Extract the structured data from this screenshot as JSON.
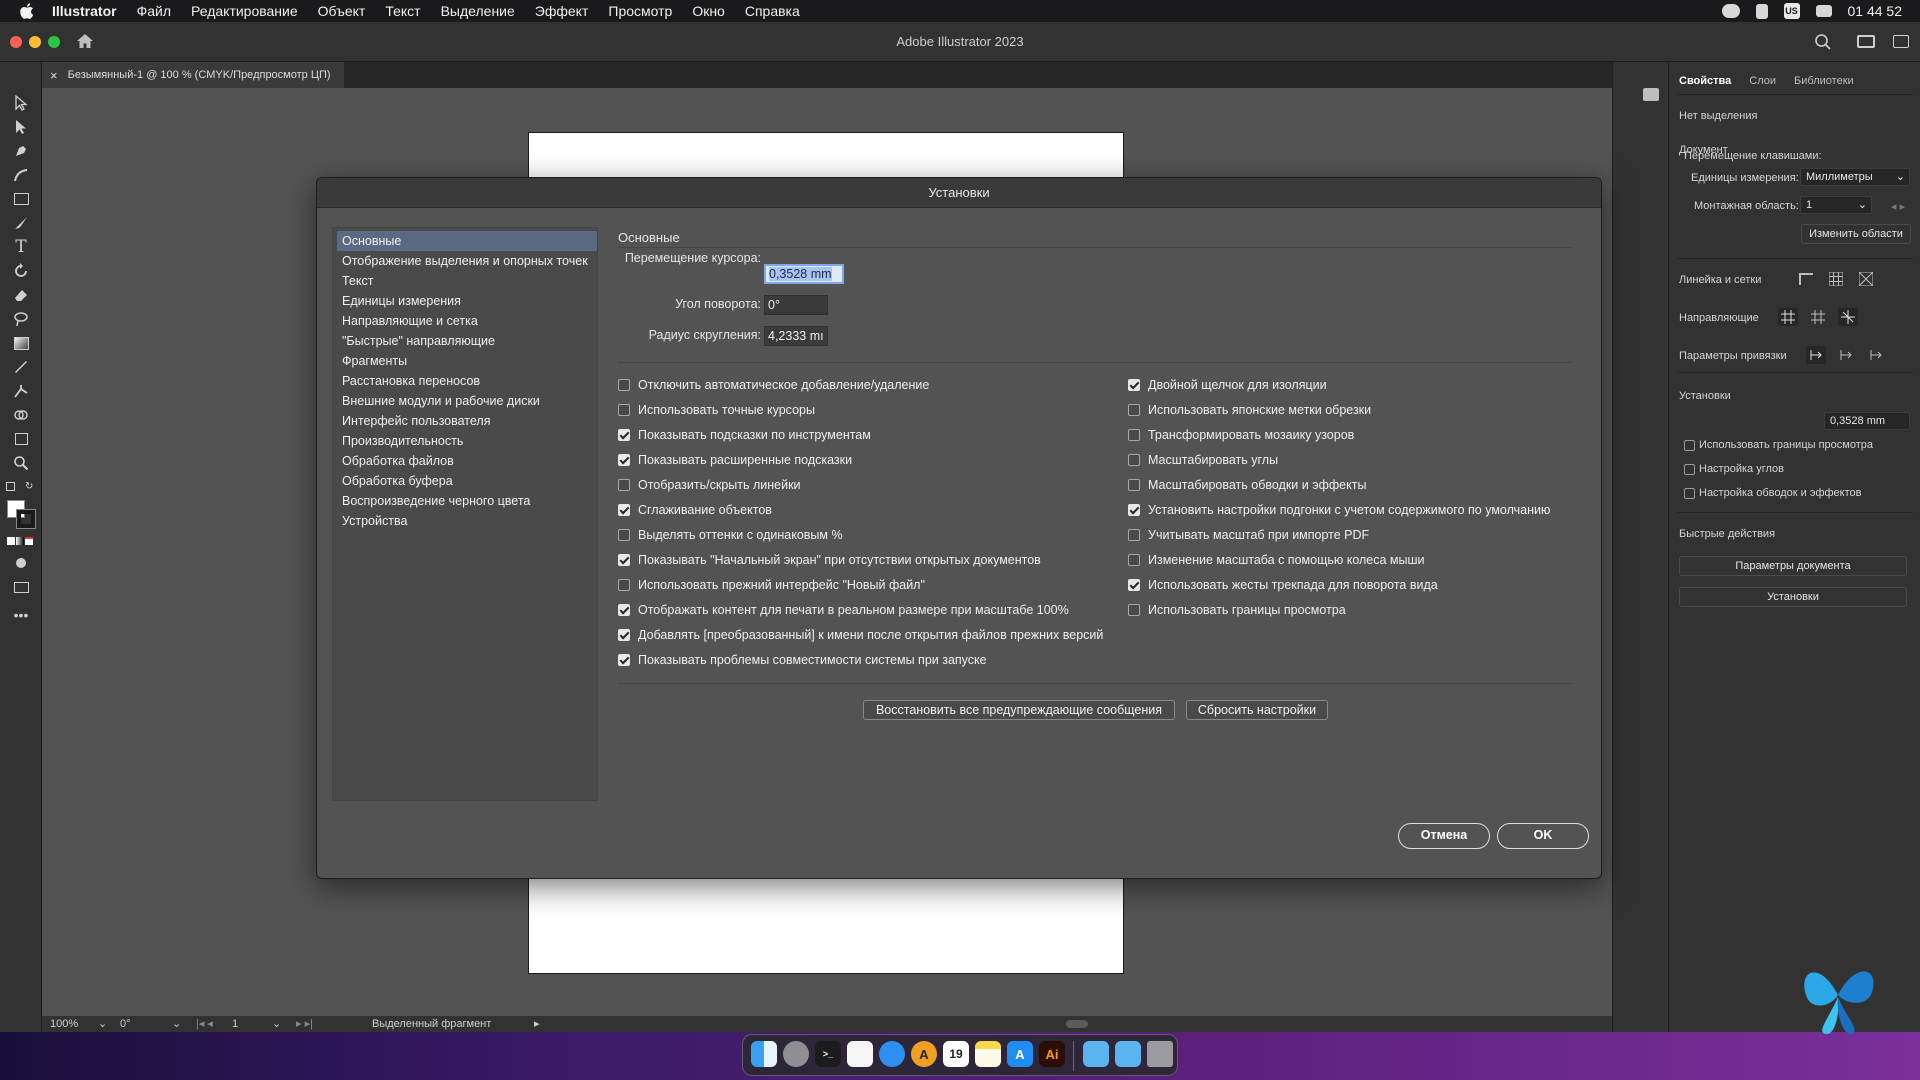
{
  "menubar": {
    "items": [
      "Illustrator",
      "Файл",
      "Редактирование",
      "Объект",
      "Текст",
      "Выделение",
      "Эффект",
      "Просмотр",
      "Окно",
      "Справка"
    ],
    "clock": "01 44 52",
    "input_source": "US"
  },
  "window": {
    "title": "Adobe Illustrator 2023"
  },
  "doc_tab": {
    "label": "Безымянный-1 @ 100 % (CMYK/Предпросмотр ЦП)",
    "close": "×"
  },
  "statusbar": {
    "zoom": "100%",
    "rotation": "0°",
    "artboard": "1",
    "info": "Выделенный фрагмент"
  },
  "props": {
    "tabs": [
      "Свойства",
      "Слои",
      "Библиотеки"
    ],
    "no_selection": "Нет выделения",
    "document": "Документ",
    "units_label": "Единицы измерения:",
    "units_value": "Миллиметры",
    "artboard_label": "Монтажная область:",
    "artboard_value": "1",
    "edit_artboards": "Изменить области",
    "rulers_grids": "Линейка и сетки",
    "guides": "Направляющие",
    "snap_options": "Параметры привязки",
    "preferences": "Установки",
    "keyboard_increment_label": "Перемещение клавишами:",
    "keyboard_increment_value": "0,3528 mm",
    "checks": [
      "Использовать границы просмотра",
      "Настройка углов",
      "Настройка обводок и эффектов"
    ],
    "quick_actions": "Быстрые действия",
    "doc_setup_btn": "Параметры документа",
    "prefs_btn": "Установки"
  },
  "dialog": {
    "title": "Установки",
    "nav": [
      "Основные",
      "Отображение выделения и опорных точек",
      "Текст",
      "Единицы измерения",
      "Направляющие и сетка",
      "\"Быстрые\" направляющие",
      "Фрагменты",
      "Расстановка переносов",
      "Внешние модули и рабочие диски",
      "Интерфейс пользователя",
      "Производительность",
      "Обработка файлов",
      "Обработка буфера",
      "Воспроизведение черного цвета",
      "Устройства"
    ],
    "section": "Основные",
    "fields": [
      {
        "label": "Перемещение курсора:",
        "value": "0,3528 mm"
      },
      {
        "label": "Угол поворота:",
        "value": "0°"
      },
      {
        "label": "Радиус скругления:",
        "value": "4,2333 mı"
      }
    ],
    "left_checks": [
      {
        "label": "Отключить автоматическое добавление/удаление",
        "checked": false
      },
      {
        "label": "Использовать точные курсоры",
        "checked": false
      },
      {
        "label": "Показывать подсказки по инструментам",
        "checked": true
      },
      {
        "label": "Показывать расширенные подсказки",
        "checked": true
      },
      {
        "label": "Отобразить/скрыть линейки",
        "checked": false
      },
      {
        "label": "Сглаживание объектов",
        "checked": true
      },
      {
        "label": "Выделять оттенки с одинаковым %",
        "checked": false
      },
      {
        "label": "Показывать \"Начальный экран\" при отсутствии открытых документов",
        "checked": true
      },
      {
        "label": "Использовать прежний интерфейс \"Новый файл\"",
        "checked": false
      },
      {
        "label": "Отображать контент для печати в реальном размере при масштабе 100%",
        "checked": true
      },
      {
        "label": "Добавлять [преобразованный] к имени после открытия файлов прежних версий",
        "checked": true
      },
      {
        "label": "Показывать проблемы совместимости системы при запуске",
        "checked": true
      }
    ],
    "right_checks": [
      {
        "label": "Двойной щелчок для изоляции",
        "checked": true
      },
      {
        "label": "Использовать японские метки обрезки",
        "checked": false
      },
      {
        "label": "Трансформировать мозаику узоров",
        "checked": false
      },
      {
        "label": "Масштабировать углы",
        "checked": false
      },
      {
        "label": "Масштабировать обводки и эффекты",
        "checked": false
      },
      {
        "label": "Установить настройки подгонки с учетом содержимого по умолчанию",
        "checked": true
      },
      {
        "label": "Учитывать масштаб при импорте PDF",
        "checked": false
      },
      {
        "label": "Изменение масштаба с помощью колеса мыши",
        "checked": false
      },
      {
        "label": "Использовать жесты трекпада для поворота вида",
        "checked": true
      },
      {
        "label": "Использовать границы просмотра",
        "checked": false
      }
    ],
    "restore_warnings": "Восстановить все предупреждающие сообщения",
    "reset_prefs": "Сбросить настройки",
    "cancel": "Отмена",
    "ok": "OK"
  },
  "dock": {
    "calendar_day": "19",
    "ai_label": "Ai"
  },
  "colors": {
    "accent": "#5a6a83",
    "canvas": "#535353",
    "panel": "#323232"
  }
}
